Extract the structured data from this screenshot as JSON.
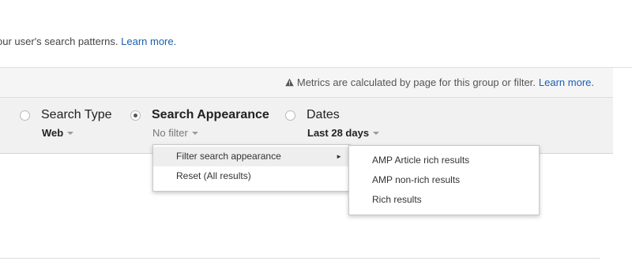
{
  "intro": {
    "text": "our user's search patterns.",
    "link": "Learn more."
  },
  "notice": {
    "icon": "warning-icon",
    "text": "Metrics are calculated by page for this group or filter.",
    "link": "Learn more."
  },
  "filters": {
    "search_type": {
      "label": "Search Type",
      "value": "Web",
      "selected": false
    },
    "search_appearance": {
      "label": "Search Appearance",
      "value": "No filter",
      "selected": true
    },
    "dates": {
      "label": "Dates",
      "value": "Last 28 days",
      "selected": false
    }
  },
  "menu": {
    "items": [
      {
        "label": "Filter search appearance",
        "has_submenu": true,
        "submenu_arrow": "►"
      },
      {
        "label": "Reset (All results)"
      }
    ]
  },
  "submenu": {
    "items": [
      {
        "label": "AMP Article rich results"
      },
      {
        "label": "AMP non-rich results"
      },
      {
        "label": "Rich results"
      }
    ]
  },
  "colors": {
    "link": "#1a5fb4",
    "bar_bg": "#f1f1f1",
    "notice_bg": "#f5f5f5"
  }
}
